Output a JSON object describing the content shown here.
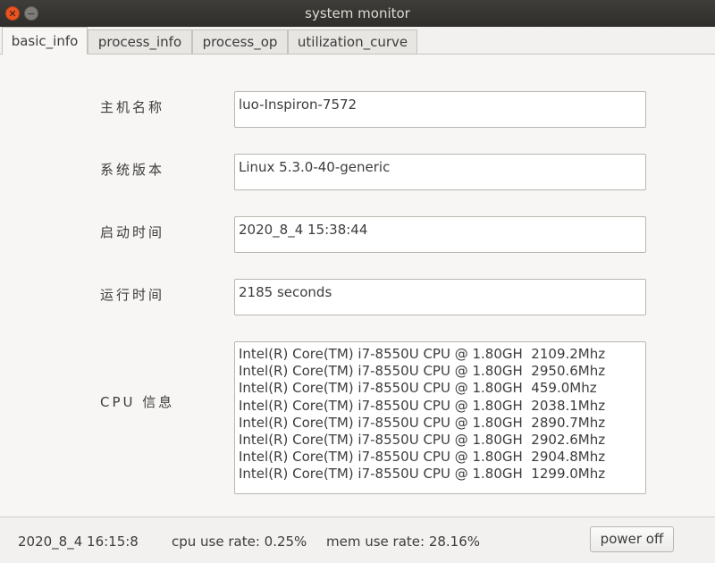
{
  "window": {
    "title": "system monitor"
  },
  "tabs": [
    {
      "label": "basic_info"
    },
    {
      "label": "process_info"
    },
    {
      "label": "process_op"
    },
    {
      "label": "utilization_curve"
    }
  ],
  "basic_info": {
    "hostname": {
      "label": "主机名称",
      "value": "luo-Inspiron-7572"
    },
    "version": {
      "label": "系统版本",
      "value": "Linux 5.3.0-40-generic"
    },
    "boot_time": {
      "label": "启动时间",
      "value": "2020_8_4 15:38:44"
    },
    "uptime": {
      "label": "运行时间",
      "value": "2185 seconds"
    },
    "cpu": {
      "label": "CPU 信息",
      "lines": [
        "Intel(R) Core(TM) i7-8550U CPU @ 1.80GH  2109.2Mhz",
        "Intel(R) Core(TM) i7-8550U CPU @ 1.80GH  2950.6Mhz",
        "Intel(R) Core(TM) i7-8550U CPU @ 1.80GH  459.0Mhz",
        "Intel(R) Core(TM) i7-8550U CPU @ 1.80GH  2038.1Mhz",
        "Intel(R) Core(TM) i7-8550U CPU @ 1.80GH  2890.7Mhz",
        "Intel(R) Core(TM) i7-8550U CPU @ 1.80GH  2902.6Mhz",
        "Intel(R) Core(TM) i7-8550U CPU @ 1.80GH  2904.8Mhz",
        "Intel(R) Core(TM) i7-8550U CPU @ 1.80GH  1299.0Mhz"
      ]
    }
  },
  "status": {
    "datetime": "2020_8_4 16:15:8",
    "cpu_rate": "cpu use rate: 0.25%",
    "mem_rate": "mem use rate: 28.16%",
    "power_label": "power off"
  }
}
